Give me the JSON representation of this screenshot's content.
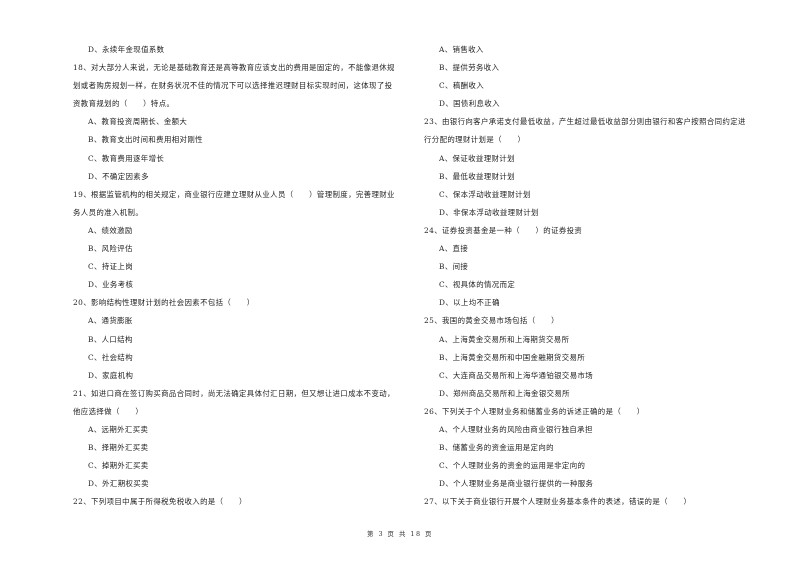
{
  "left_column": [
    {
      "type": "option",
      "text": "D、永续年金现值系数"
    },
    {
      "type": "question",
      "text": "18、对大部分人来说，无论是基础教育还是高等教育应该支出的费用是固定的，不能像退休规"
    },
    {
      "type": "question",
      "text": "划或者购房规划一样，在财务状况不佳的情况下可以选择推迟理财目标实现时间，这体现了投"
    },
    {
      "type": "question",
      "text": "资教育规划的（　　）特点。"
    },
    {
      "type": "option",
      "text": "A、教育投资周期长、金额大"
    },
    {
      "type": "option",
      "text": "B、教育支出时间和费用相对刚性"
    },
    {
      "type": "option",
      "text": "C、教育费用逐年增长"
    },
    {
      "type": "option",
      "text": "D、不确定因素多"
    },
    {
      "type": "question",
      "text": "19、根据监管机构的相关规定，商业银行应建立理财从业人员（　　）管理制度，完善理财业"
    },
    {
      "type": "question",
      "text": "务人员的准入机制。"
    },
    {
      "type": "option",
      "text": "A、绩效激励"
    },
    {
      "type": "option",
      "text": "B、风险评估"
    },
    {
      "type": "option",
      "text": "C、持证上岗"
    },
    {
      "type": "option",
      "text": "D、业务考核"
    },
    {
      "type": "question",
      "text": "20、影响结构性理财计划的社会因素不包括（　　）"
    },
    {
      "type": "option",
      "text": "A、通货膨胀"
    },
    {
      "type": "option",
      "text": "B、人口结构"
    },
    {
      "type": "option",
      "text": "C、社会结构"
    },
    {
      "type": "option",
      "text": "D、家庭机构"
    },
    {
      "type": "question",
      "text": "21、如进口商在签订购买商品合同时，尚无法确定具体付汇日期，但又想让进口成本不变动，"
    },
    {
      "type": "question",
      "text": "他应选择做（　　）"
    },
    {
      "type": "option",
      "text": "A、远期外汇买卖"
    },
    {
      "type": "option",
      "text": "B、择期外汇买卖"
    },
    {
      "type": "option",
      "text": "C、掉期外汇买卖"
    },
    {
      "type": "option",
      "text": "D、外汇期权买卖"
    },
    {
      "type": "question",
      "text": "22、下列项目中属于所得税免税收入的是（　　）"
    }
  ],
  "right_column": [
    {
      "type": "option",
      "text": "A、销售收入"
    },
    {
      "type": "option",
      "text": "B、提供劳务收入"
    },
    {
      "type": "option",
      "text": "C、稿酬收入"
    },
    {
      "type": "option",
      "text": "D、国债利息收入"
    },
    {
      "type": "question",
      "text": "23、由银行向客户承诺支付最低收益，产生超过最低收益部分则由银行和客户按照合同约定进"
    },
    {
      "type": "question",
      "text": "行分配的理财计划是（　　）"
    },
    {
      "type": "option",
      "text": "A、保证收益理财计划"
    },
    {
      "type": "option",
      "text": "B、最低收益理财计划"
    },
    {
      "type": "option",
      "text": "C、保本浮动收益理财计划"
    },
    {
      "type": "option",
      "text": "D、非保本浮动收益理财计划"
    },
    {
      "type": "question",
      "text": "24、证券投资基金是一种（　　）的证券投资"
    },
    {
      "type": "option",
      "text": "A、直接"
    },
    {
      "type": "option",
      "text": "B、间接"
    },
    {
      "type": "option",
      "text": "C、视具体的情况而定"
    },
    {
      "type": "option",
      "text": "D、以上均不正确"
    },
    {
      "type": "question",
      "text": "25、我国的黄金交易市场包括（　　）"
    },
    {
      "type": "option",
      "text": "A、上海黄金交易所和上海期货交易所"
    },
    {
      "type": "option",
      "text": "B、上海黄金交易所和中国金融期货交易所"
    },
    {
      "type": "option",
      "text": "C、大连商品交易所和上海华通铂银交易市场"
    },
    {
      "type": "option",
      "text": "D、郑州商品交易所和上海金银交易所"
    },
    {
      "type": "question",
      "text": "26、下列关于个人理财业务和储蓄业务的诉述正确的是（　　）"
    },
    {
      "type": "option",
      "text": "A、个人理财业务的风险由商业银行独自承担"
    },
    {
      "type": "option",
      "text": "B、储蓄业务的资金运用是定向的"
    },
    {
      "type": "option",
      "text": "C、个人理财业务的资金的运用是非定向的"
    },
    {
      "type": "option",
      "text": "D、个人理财业务是商业银行提供的一种服务"
    },
    {
      "type": "question",
      "text": "27、以下关于商业银行开展个人理财业务基本条件的表述，错误的是（　　）"
    }
  ],
  "footer": {
    "page_label": "第 3 页 共 18 页"
  }
}
